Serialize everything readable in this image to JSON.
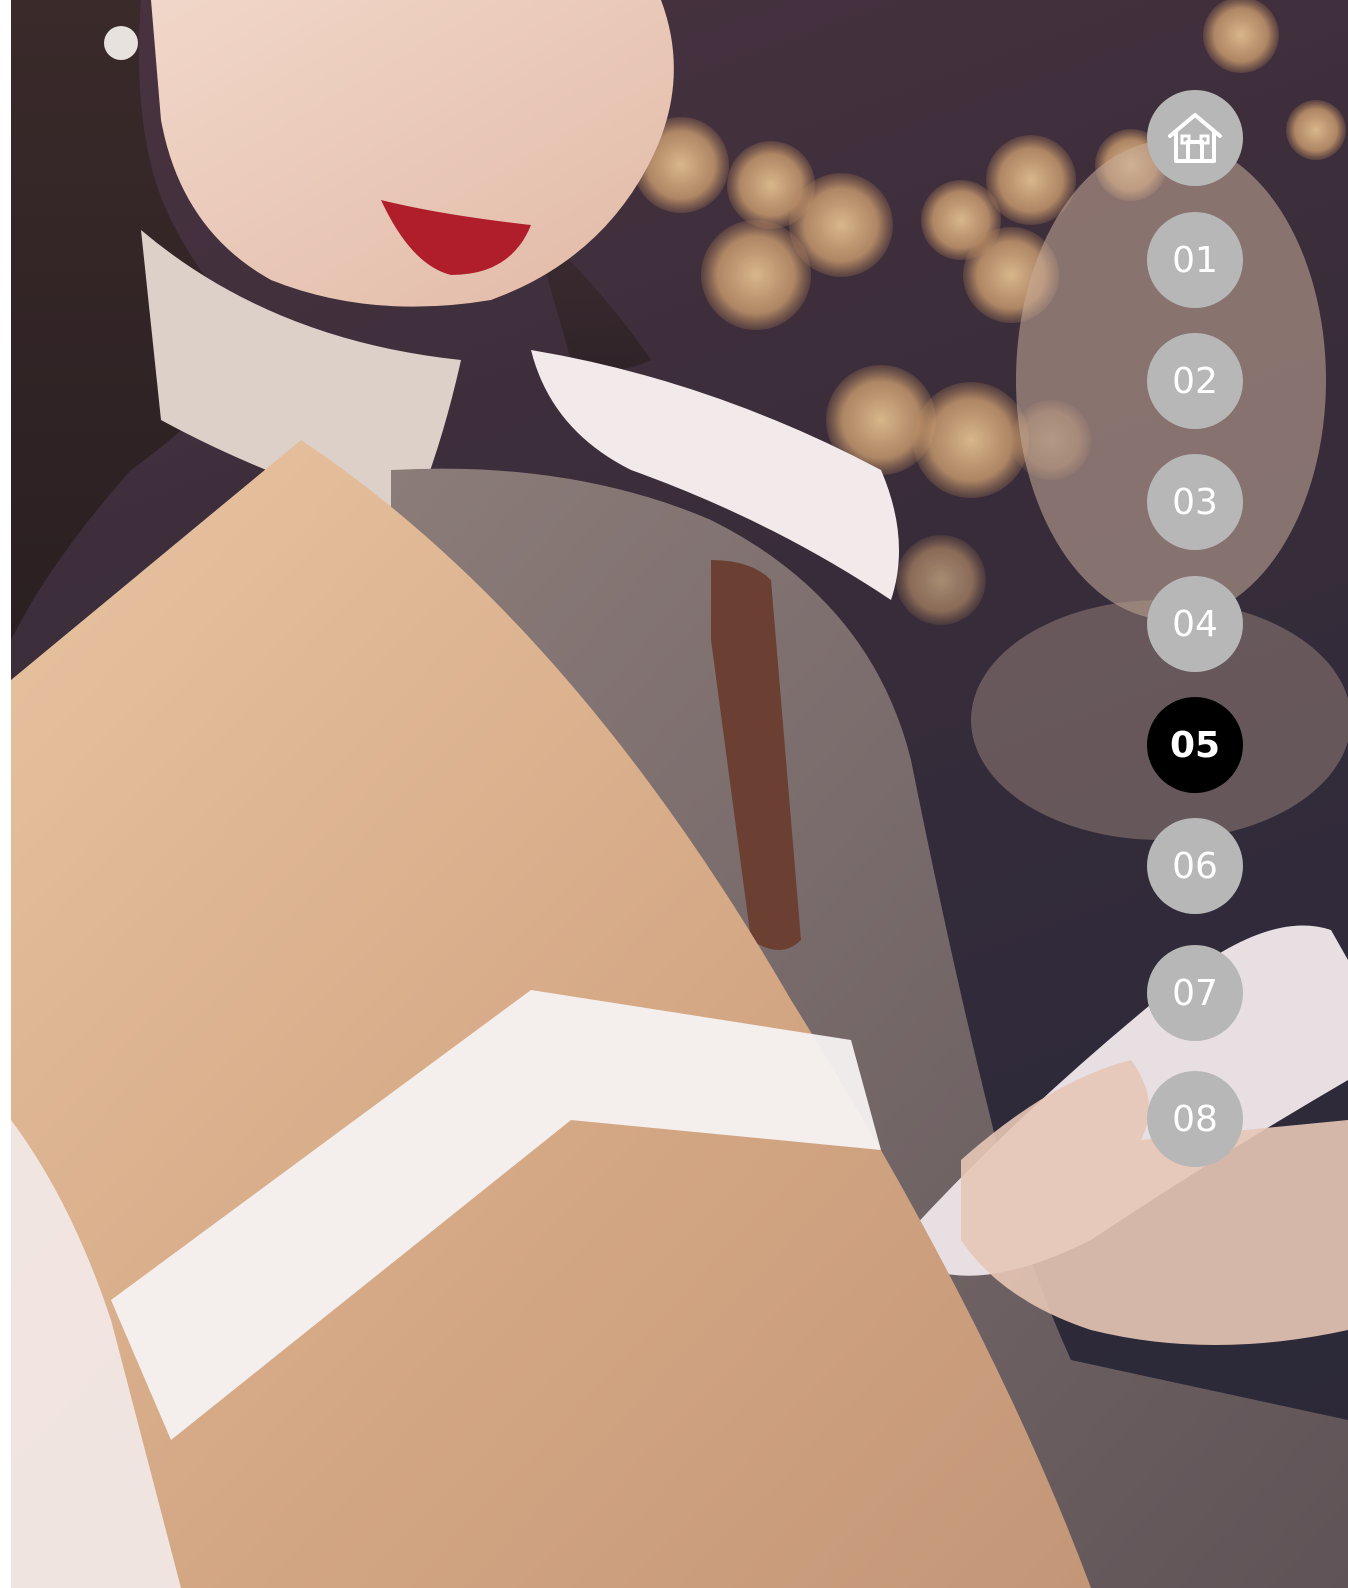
{
  "navigation": {
    "home_icon": "home-icon",
    "pages": [
      {
        "label": "01",
        "active": false
      },
      {
        "label": "02",
        "active": false
      },
      {
        "label": "03",
        "active": false
      },
      {
        "label": "04",
        "active": false
      },
      {
        "label": "05",
        "active": true
      },
      {
        "label": "06",
        "active": false
      },
      {
        "label": "07",
        "active": false
      },
      {
        "label": "08",
        "active": false
      }
    ],
    "colors": {
      "inactive": "#b7b7b7",
      "active": "#000000",
      "text": "#ffffff"
    }
  },
  "hero": {
    "image": "woman-holding-gift-and-phone-photo"
  }
}
